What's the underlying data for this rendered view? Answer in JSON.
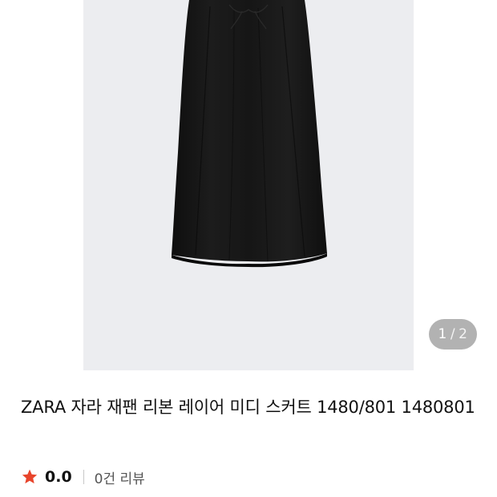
{
  "gallery": {
    "current_page": "1",
    "separator": "/",
    "total_pages": "2"
  },
  "product": {
    "title": "ZARA 자라 재팬 리본 레이어 미디 스커트 1480/801 1480801"
  },
  "rating": {
    "score": "0.0",
    "review_count_label": "0건 리뷰",
    "star_color": "#e8452c"
  },
  "icons": {
    "rating": "star-icon"
  },
  "colors": {
    "backdrop": "#ecedf0",
    "skirt": "#171717",
    "badge_bg": "#8c8c8c"
  }
}
